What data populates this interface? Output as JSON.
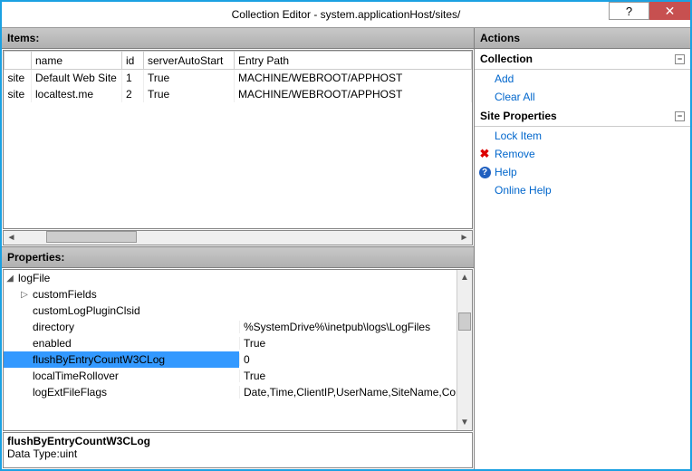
{
  "title": "Collection Editor - system.applicationHost/sites/",
  "items": {
    "header": "Items:",
    "cols": {
      "c0": "",
      "c1": "name",
      "c2": "id",
      "c3": "serverAutoStart",
      "c4": "Entry Path"
    },
    "rows": [
      {
        "c0": "site",
        "c1": "Default Web Site",
        "c2": "1",
        "c3": "True",
        "c4": "MACHINE/WEBROOT/APPHOST"
      },
      {
        "c0": "site",
        "c1": "localtest.me",
        "c2": "2",
        "c3": "True",
        "c4": "MACHINE/WEBROOT/APPHOST"
      }
    ]
  },
  "props": {
    "header": "Properties:",
    "expanded": "logFile",
    "rows": [
      {
        "n": "customFields",
        "v": "",
        "expander": true
      },
      {
        "n": "customLogPluginClsid",
        "v": ""
      },
      {
        "n": "directory",
        "v": "%SystemDrive%\\inetpub\\logs\\LogFiles"
      },
      {
        "n": "enabled",
        "v": "True"
      },
      {
        "n": "flushByEntryCountW3CLog",
        "v": "0",
        "selected": true
      },
      {
        "n": "localTimeRollover",
        "v": "True"
      },
      {
        "n": "logExtFileFlags",
        "v": "Date,Time,ClientIP,UserName,SiteName,Comp"
      }
    ],
    "desc_name": "flushByEntryCountW3CLog",
    "desc_type": "Data Type:uint"
  },
  "actions": {
    "header": "Actions",
    "collection": {
      "title": "Collection",
      "add": "Add",
      "clear": "Clear All"
    },
    "siteprops": {
      "title": "Site Properties",
      "lock": "Lock Item",
      "remove": "Remove"
    },
    "help": {
      "help": "Help",
      "online": "Online Help"
    }
  }
}
